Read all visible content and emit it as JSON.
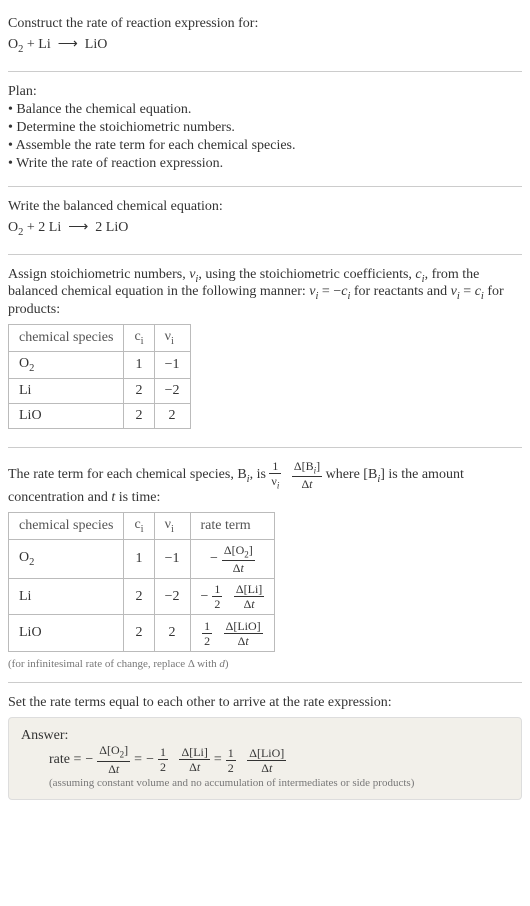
{
  "header": {
    "prompt": "Construct the rate of reaction expression for:",
    "equation_html": "O<sub>2</sub> + Li &nbsp;⟶&nbsp; LiO"
  },
  "plan": {
    "title": "Plan:",
    "items": [
      "• Balance the chemical equation.",
      "• Determine the stoichiometric numbers.",
      "• Assemble the rate term for each chemical species.",
      "• Write the rate of reaction expression."
    ]
  },
  "balanced": {
    "title": "Write the balanced chemical equation:",
    "equation_html": "O<sub>2</sub> + 2 Li &nbsp;⟶&nbsp; 2 LiO"
  },
  "assign": {
    "para_html": "Assign stoichiometric numbers, <span class='ital'>ν<sub>i</sub></span>, using the stoichiometric coefficients, <span class='ital'>c<sub>i</sub></span>, from the balanced chemical equation in the following manner: <span class='ital'>ν<sub>i</sub></span> = −<span class='ital'>c<sub>i</sub></span> for reactants and <span class='ital'>ν<sub>i</sub></span> = <span class='ital'>c<sub>i</sub></span> for products:",
    "table": {
      "headers": [
        "chemical species",
        "c<sub>i</sub>",
        "ν<sub>i</sub>"
      ],
      "rows": [
        [
          "O<sub>2</sub>",
          "1",
          "−1"
        ],
        [
          "Li",
          "2",
          "−2"
        ],
        [
          "LiO",
          "2",
          "2"
        ]
      ]
    }
  },
  "rateterm": {
    "para_pre": "The rate term for each chemical species, B<sub><i>i</i></sub>, is ",
    "frac1_num": "1",
    "frac1_den": "ν<sub><i>i</i></sub>",
    "frac2_num": "Δ[B<sub><i>i</i></sub>]",
    "frac2_den": "Δ<i>t</i>",
    "para_post": " where [B<sub><i>i</i></sub>] is the amount concentration and <i>t</i> is time:",
    "table": {
      "headers": [
        "chemical species",
        "c<sub>i</sub>",
        "ν<sub>i</sub>",
        "rate term"
      ],
      "rows": [
        {
          "sp": "O<sub>2</sub>",
          "c": "1",
          "v": "−1",
          "sign": "−",
          "coef_num": "",
          "coef_den": "",
          "num": "Δ[O<sub>2</sub>]",
          "den": "Δ<i>t</i>"
        },
        {
          "sp": "Li",
          "c": "2",
          "v": "−2",
          "sign": "−",
          "coef_num": "1",
          "coef_den": "2",
          "num": "Δ[Li]",
          "den": "Δ<i>t</i>"
        },
        {
          "sp": "LiO",
          "c": "2",
          "v": "2",
          "sign": "",
          "coef_num": "1",
          "coef_den": "2",
          "num": "Δ[LiO]",
          "den": "Δ<i>t</i>"
        }
      ]
    },
    "note": "(for infinitesimal rate of change, replace Δ with <i>d</i>)"
  },
  "final": {
    "title": "Set the rate terms equal to each other to arrive at the rate expression:",
    "answer_label": "Answer:",
    "rate_label": "rate = ",
    "terms": [
      {
        "sign": "−",
        "coef_num": "",
        "coef_den": "",
        "num": "Δ[O<sub>2</sub>]",
        "den": "Δ<i>t</i>"
      },
      {
        "sign": "−",
        "coef_num": "1",
        "coef_den": "2",
        "num": "Δ[Li]",
        "den": "Δ<i>t</i>"
      },
      {
        "sign": "",
        "coef_num": "1",
        "coef_den": "2",
        "num": "Δ[LiO]",
        "den": "Δ<i>t</i>"
      }
    ],
    "note": "(assuming constant volume and no accumulation of intermediates or side products)"
  },
  "chart_data": {
    "type": "table",
    "title": "Stoichiometric numbers and rate terms",
    "tables": [
      {
        "name": "stoichiometric_numbers",
        "columns": [
          "chemical species",
          "c_i",
          "nu_i"
        ],
        "rows": [
          [
            "O2",
            1,
            -1
          ],
          [
            "Li",
            2,
            -2
          ],
          [
            "LiO",
            2,
            2
          ]
        ]
      },
      {
        "name": "rate_terms",
        "columns": [
          "chemical species",
          "c_i",
          "nu_i",
          "rate term"
        ],
        "rows": [
          [
            "O2",
            1,
            -1,
            "-Δ[O2]/Δt"
          ],
          [
            "Li",
            2,
            -2,
            "-(1/2) Δ[Li]/Δt"
          ],
          [
            "LiO",
            2,
            2,
            "(1/2) Δ[LiO]/Δt"
          ]
        ]
      }
    ],
    "rate_expression": "rate = -Δ[O2]/Δt = -(1/2) Δ[Li]/Δt = (1/2) Δ[LiO]/Δt"
  }
}
